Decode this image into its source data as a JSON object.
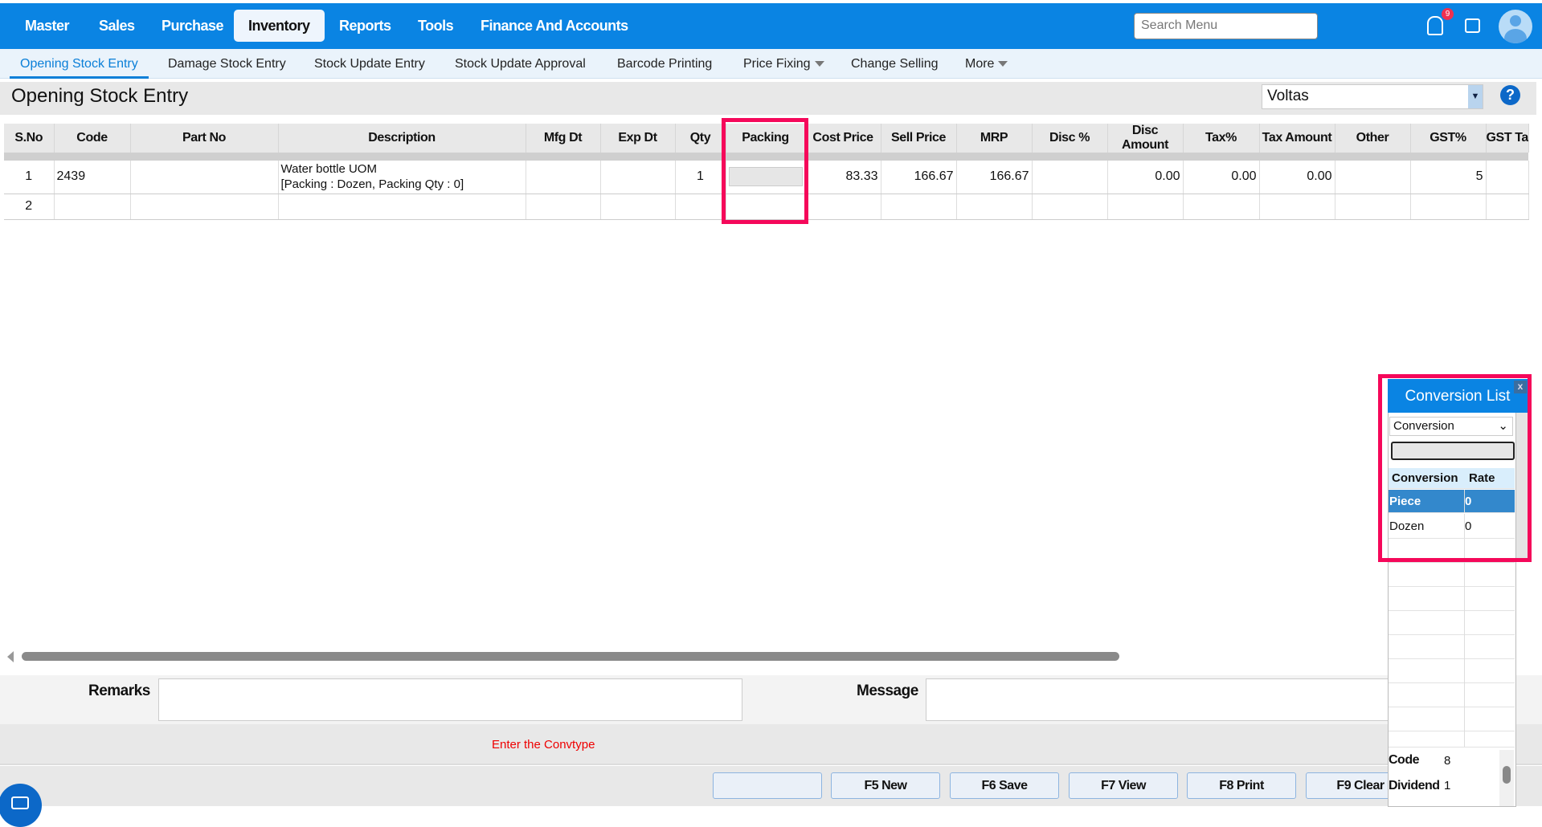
{
  "topnav": {
    "items": [
      "Master",
      "Sales",
      "Purchase",
      "Inventory",
      "Reports",
      "Tools",
      "Finance And Accounts"
    ],
    "active": "Inventory",
    "search_placeholder": "Search Menu",
    "notification_count": "9"
  },
  "subnav": {
    "items": [
      "Opening Stock Entry",
      "Damage Stock Entry",
      "Stock Update Entry",
      "Stock Update Approval",
      "Barcode Printing",
      "Price Fixing",
      "Change Selling",
      "More"
    ],
    "active": "Opening Stock Entry"
  },
  "page": {
    "title": "Opening Stock Entry",
    "company": "Voltas",
    "help": "?"
  },
  "table": {
    "columns": [
      "S.No",
      "Code",
      "Part No",
      "Description",
      "Mfg Dt",
      "Exp Dt",
      "Qty",
      "Packing",
      "Cost Price",
      "Sell Price",
      "MRP",
      "Disc %",
      "Disc Amount",
      "Tax%",
      "Tax Amount",
      "Other",
      "GST%",
      "GST Ta"
    ],
    "rows": [
      {
        "sno": "1",
        "code": "2439",
        "part_no": "",
        "desc1": "Water bottle UOM",
        "desc2": "[Packing : Dozen, Packing Qty : 0]",
        "qty": "1",
        "cost": "83.33",
        "sell": "166.67",
        "mrp": "166.67",
        "disc_amt": "0.00",
        "tax": "0.00",
        "tax_amt": "0.00",
        "gst": "5"
      },
      {
        "sno": "2"
      }
    ]
  },
  "footer": {
    "remarks_label": "Remarks",
    "message_label": "Message",
    "status_message": "Enter the Convtype",
    "buttons": [
      "",
      "F5 New",
      "F6 Save",
      "F7 View",
      "F8 Print",
      "F9 Clear"
    ]
  },
  "conversion": {
    "title": "Conversion List",
    "close": "x",
    "select_value": "Conversion",
    "headers": [
      "Conversion",
      "Rate"
    ],
    "rows": [
      {
        "name": "Piece",
        "rate": "0"
      },
      {
        "name": "Dozen",
        "rate": "0"
      }
    ],
    "code_label": "Code",
    "code_value": "8",
    "dividend_label": "Dividend",
    "dividend_value": "1"
  },
  "colors": {
    "brand": "#0a84e3",
    "highlight": "#f5085a",
    "error": "#e00000"
  }
}
